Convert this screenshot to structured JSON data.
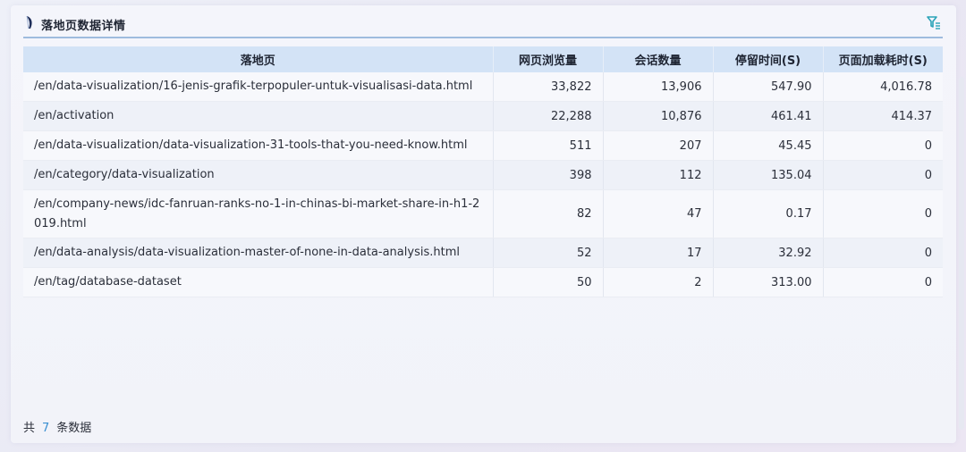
{
  "panel": {
    "title": "落地页数据详情",
    "icon": "feather-icon",
    "filter_icon": "filter-icon"
  },
  "table": {
    "columns": [
      "落地页",
      "网页浏览量",
      "会话数量",
      "停留时间(S)",
      "页面加载耗时(S)"
    ],
    "rows": [
      [
        "/en/data-visualization/16-jenis-grafik-terpopuler-untuk-visualisasi-data.html",
        "33,822",
        "13,906",
        "547.90",
        "4,016.78"
      ],
      [
        "/en/activation",
        "22,288",
        "10,876",
        "461.41",
        "414.37"
      ],
      [
        "/en/data-visualization/data-visualization-31-tools-that-you-need-know.html",
        "511",
        "207",
        "45.45",
        "0"
      ],
      [
        "/en/category/data-visualization",
        "398",
        "112",
        "135.04",
        "0"
      ],
      [
        "/en/company-news/idc-fanruan-ranks-no-1-in-chinas-bi-market-share-in-h1-2019.html",
        "82",
        "47",
        "0.17",
        "0"
      ],
      [
        "/en/data-analysis/data-visualization-master-of-none-in-data-analysis.html",
        "52",
        "17",
        "32.92",
        "0"
      ],
      [
        "/en/tag/database-dataset",
        "50",
        "2",
        "313.00",
        "0"
      ]
    ]
  },
  "footer": {
    "prefix": "共",
    "count": "7",
    "suffix": "条数据"
  },
  "colors": {
    "header_bg": "#d3e3f6",
    "accent": "#3a8fd1",
    "title_underline": "#9ebcde"
  }
}
